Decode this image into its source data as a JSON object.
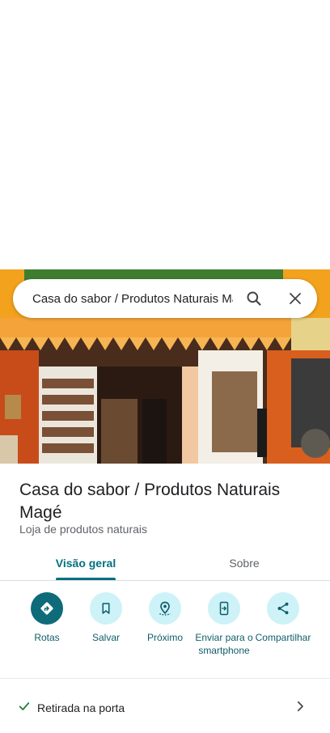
{
  "search": {
    "query": "Casa do sabor / Produtos Naturais Magé"
  },
  "place": {
    "title": "Casa do sabor / Produtos Naturais Magé",
    "category": "Loja de produtos naturais"
  },
  "tabs": [
    {
      "label": "Visão geral",
      "active": true
    },
    {
      "label": "Sobre",
      "active": false
    }
  ],
  "actions": [
    {
      "label": "Rotas",
      "icon": "directions-icon"
    },
    {
      "label": "Salvar",
      "icon": "bookmark-icon"
    },
    {
      "label": "Próximo",
      "icon": "nearby-icon"
    },
    {
      "label": "Enviar para o smartphone",
      "icon": "send-to-phone-icon"
    },
    {
      "label": "Compartilhar",
      "icon": "share-icon"
    }
  ],
  "service_options": [
    {
      "label": "Retirada na porta",
      "icon": "check-icon"
    }
  ],
  "colors": {
    "accent": "#00707f",
    "action_bg": "#cdf2f7",
    "primary_action": "#0d6b7a"
  }
}
